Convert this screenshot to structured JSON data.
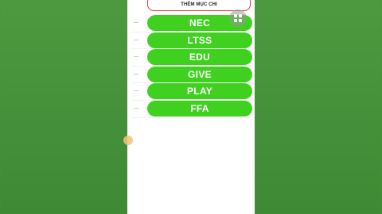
{
  "header": {
    "add_button_label": "THÊM MỤC CHI"
  },
  "categories": [
    {
      "label": "NEC"
    },
    {
      "label": "LTSS"
    },
    {
      "label": "EDU"
    },
    {
      "label": "GIVE"
    },
    {
      "label": "PLAY"
    },
    {
      "label": "FFA"
    }
  ],
  "colors": {
    "pill_green": "#3fd020",
    "accent_red": "#d83b3b",
    "background_green": "#4a8f3a"
  },
  "icons": {
    "grid_fab": "grid-icon",
    "row_handle": "drag-handle-icon"
  }
}
